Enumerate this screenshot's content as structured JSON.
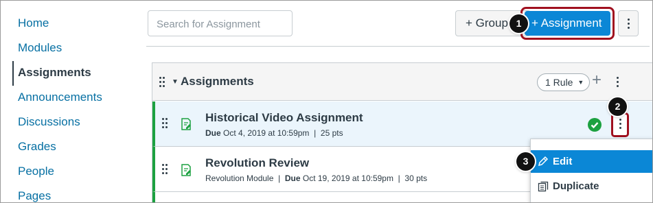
{
  "nav": {
    "items": [
      {
        "label": "Home",
        "active": false
      },
      {
        "label": "Modules",
        "active": false
      },
      {
        "label": "Assignments",
        "active": true
      },
      {
        "label": "Announcements",
        "active": false
      },
      {
        "label": "Discussions",
        "active": false
      },
      {
        "label": "Grades",
        "active": false
      },
      {
        "label": "People",
        "active": false
      },
      {
        "label": "Pages",
        "active": false
      }
    ]
  },
  "toolbar": {
    "search_placeholder": "Search for Assignment",
    "group_button": "+ Group",
    "assignment_button": "+ Assignment",
    "more_icon": "kebab-icon"
  },
  "badges": [
    "1",
    "2",
    "3"
  ],
  "group": {
    "title": "Assignments",
    "rules_label": "1 Rule",
    "add_icon": "plus-icon",
    "menu_icon": "kebab-icon"
  },
  "assignments": [
    {
      "title": "Historical Video Assignment",
      "module": "",
      "due_label": "Due",
      "due": "Oct 4, 2019 at 10:59pm",
      "points": "25 pts",
      "published": true
    },
    {
      "title": "Revolution Review",
      "module": "Revolution Module",
      "due_label": "Due",
      "due": "Oct 19, 2019 at 10:59pm",
      "points": "30 pts",
      "published": false
    }
  ],
  "menu": {
    "items": [
      {
        "label": "Edit",
        "icon": "pencil-icon",
        "highlighted": true
      },
      {
        "label": "Duplicate",
        "icon": "copy-icon",
        "highlighted": false
      }
    ]
  },
  "colors": {
    "accent": "#0b87d6",
    "link": "#0770a3",
    "published": "#1ca140",
    "highlight": "#a0101f"
  }
}
